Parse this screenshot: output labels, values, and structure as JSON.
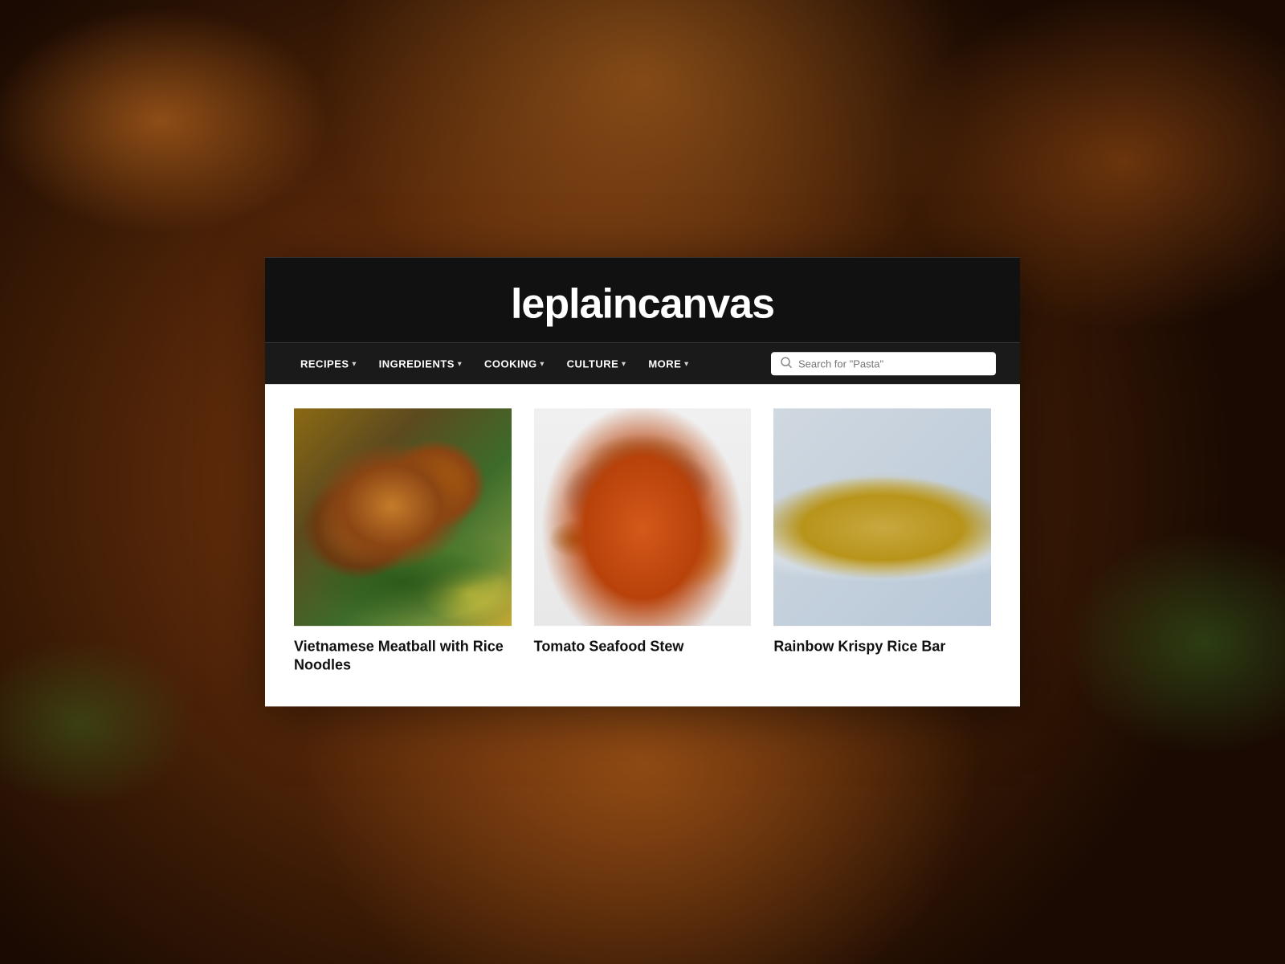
{
  "site": {
    "title": "leplaincanvas"
  },
  "nav": {
    "items": [
      {
        "label": "RECIPES",
        "has_dropdown": true
      },
      {
        "label": "INGREDIENTS",
        "has_dropdown": true
      },
      {
        "label": "COOKING",
        "has_dropdown": true
      },
      {
        "label": "CULTURE",
        "has_dropdown": true
      },
      {
        "label": "MORE",
        "has_dropdown": true
      }
    ]
  },
  "search": {
    "placeholder": "Search for \"Pasta\""
  },
  "recipes": [
    {
      "id": 1,
      "title": "Vietnamese Meatball with Rice Noodles",
      "image_alt": "Vietnamese meatball dish with herbs and rice noodles on a plate"
    },
    {
      "id": 2,
      "title": "Tomato Seafood Stew",
      "image_alt": "Tomato seafood stew with mussels and shrimp on a white platter"
    },
    {
      "id": 3,
      "title": "Rainbow Krispy Rice Bar",
      "image_alt": "Rainbow krispy rice bar with colorful sprinkles and marshmallows"
    }
  ]
}
